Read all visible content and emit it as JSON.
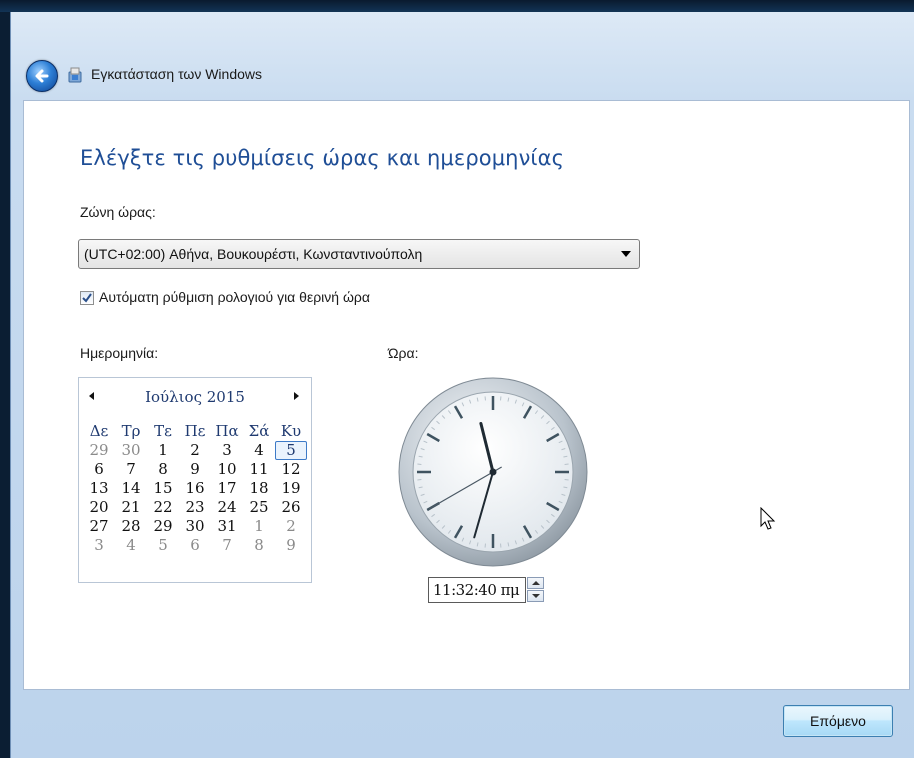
{
  "window": {
    "title": "Εγκατάσταση των Windows",
    "back_icon": "back-arrow-icon",
    "app_icon": "windows-setup-icon"
  },
  "main": {
    "heading": "Ελέγξτε τις ρυθμίσεις ώρας και ημερομηνίας",
    "timezone_label": "Ζώνη ώρας:",
    "timezone_value": "(UTC+02:00) Αθήνα, Βουκουρέστι, Κωνσταντινούπολη",
    "dst_checkbox_label": "Αυτόματη ρύθμιση ρολογιού για θερινή ώρα",
    "dst_checked": true,
    "date_label": "Ημερομηνία:",
    "time_label": "Ώρα:"
  },
  "calendar": {
    "month_year": "Ιούλιος 2015",
    "weekdays": [
      "Δε",
      "Τρ",
      "Τε",
      "Πε",
      "Πα",
      "Σά",
      "Κυ"
    ],
    "weeks": [
      [
        "29",
        "30",
        "1",
        "2",
        "3",
        "4",
        "5"
      ],
      [
        "6",
        "7",
        "8",
        "9",
        "10",
        "11",
        "12"
      ],
      [
        "13",
        "14",
        "15",
        "16",
        "17",
        "18",
        "19"
      ],
      [
        "20",
        "21",
        "22",
        "23",
        "24",
        "25",
        "26"
      ],
      [
        "27",
        "28",
        "29",
        "30",
        "31",
        "1",
        "2"
      ],
      [
        "3",
        "4",
        "5",
        "6",
        "7",
        "8",
        "9"
      ]
    ],
    "selected_day": "5"
  },
  "clock": {
    "time_text": "11:32:40 πμ",
    "hours": 11,
    "minutes": 32,
    "seconds": 40
  },
  "footer": {
    "next_label": "Επόμενο"
  },
  "colors": {
    "heading": "#1f4e96",
    "frame": "#bcd3ec",
    "selected_border": "#3d7ac7"
  }
}
